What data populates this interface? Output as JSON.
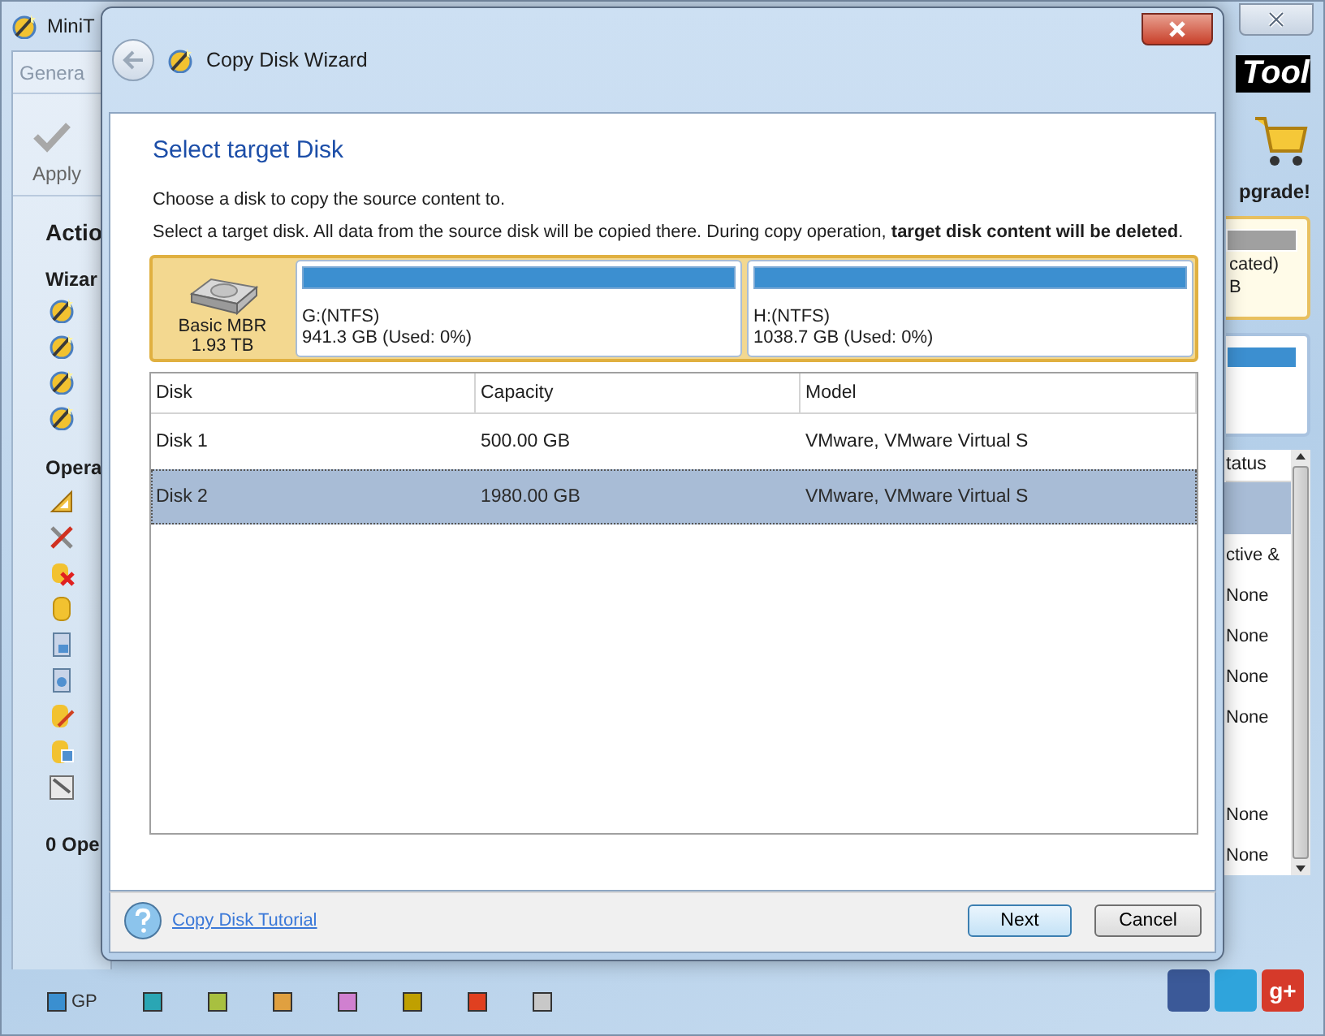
{
  "app": {
    "title": "MiniT",
    "tab": "Genera",
    "apply": "Apply",
    "actions_heading": "Actio",
    "wizards_heading": "Wizar",
    "operations_heading": "Opera",
    "pending": "0 Ope",
    "logo": "Tool",
    "upgrade": "pgrade!",
    "disk_cards": [
      {
        "kind": "unallocated",
        "selected": true,
        "lines": [
          "cated)",
          "B"
        ]
      },
      {
        "kind": "partition",
        "selected": false
      }
    ],
    "status_table": {
      "header": "tatus",
      "rows": [
        {
          "selected": true
        },
        {
          "status": "ctive &",
          "selected": false
        },
        {
          "status": "None",
          "selected": false
        },
        {
          "status": "None",
          "selected": false
        },
        {
          "status": "None",
          "selected": false
        },
        {
          "status": "None",
          "selected": false
        },
        {
          "kind": "blank"
        },
        {
          "status": "None",
          "selected": false
        },
        {
          "status": "None",
          "selected": false
        }
      ]
    },
    "legend": [
      {
        "label": "GP",
        "color": "#3a8fd0"
      },
      {
        "color": "#2aa6b4"
      },
      {
        "color": "#a8c040"
      },
      {
        "color": "#e0a040"
      },
      {
        "color": "#d080d0"
      },
      {
        "color": "#c0a000"
      },
      {
        "color": "#e04020"
      },
      {
        "color": "#c8c8c8"
      }
    ],
    "social": {
      "gplus": "g+"
    }
  },
  "dialog": {
    "title": "Copy Disk Wizard",
    "heading": "Select target Disk",
    "instruction": "Choose a disk to copy the source content to.",
    "warning": "Select a target disk. All data from the source disk will be copied there. During copy operation, **target disk content will be deleted**.",
    "disk_map": {
      "selected": true,
      "type": "Basic MBR",
      "size": "1.93 TB",
      "partitions": [
        {
          "name": "G:(NTFS)",
          "details": "941.3 GB (Used: 0%)"
        },
        {
          "name": "H:(NTFS)",
          "details": "1038.7 GB (Used: 0%)"
        }
      ]
    },
    "table": {
      "columns": [
        "Disk",
        "Capacity",
        "Model"
      ],
      "rows": [
        {
          "cells": [
            "Disk 1",
            "500.00 GB",
            "VMware, VMware Virtual S"
          ],
          "selected": false
        },
        {
          "cells": [
            "Disk 2",
            "1980.00 GB",
            "VMware, VMware Virtual S"
          ],
          "selected": true
        }
      ]
    },
    "tutorial_link": "Copy Disk Tutorial",
    "buttons": [
      {
        "label": "Next",
        "default": true
      },
      {
        "label": "Cancel",
        "default": false
      }
    ]
  }
}
